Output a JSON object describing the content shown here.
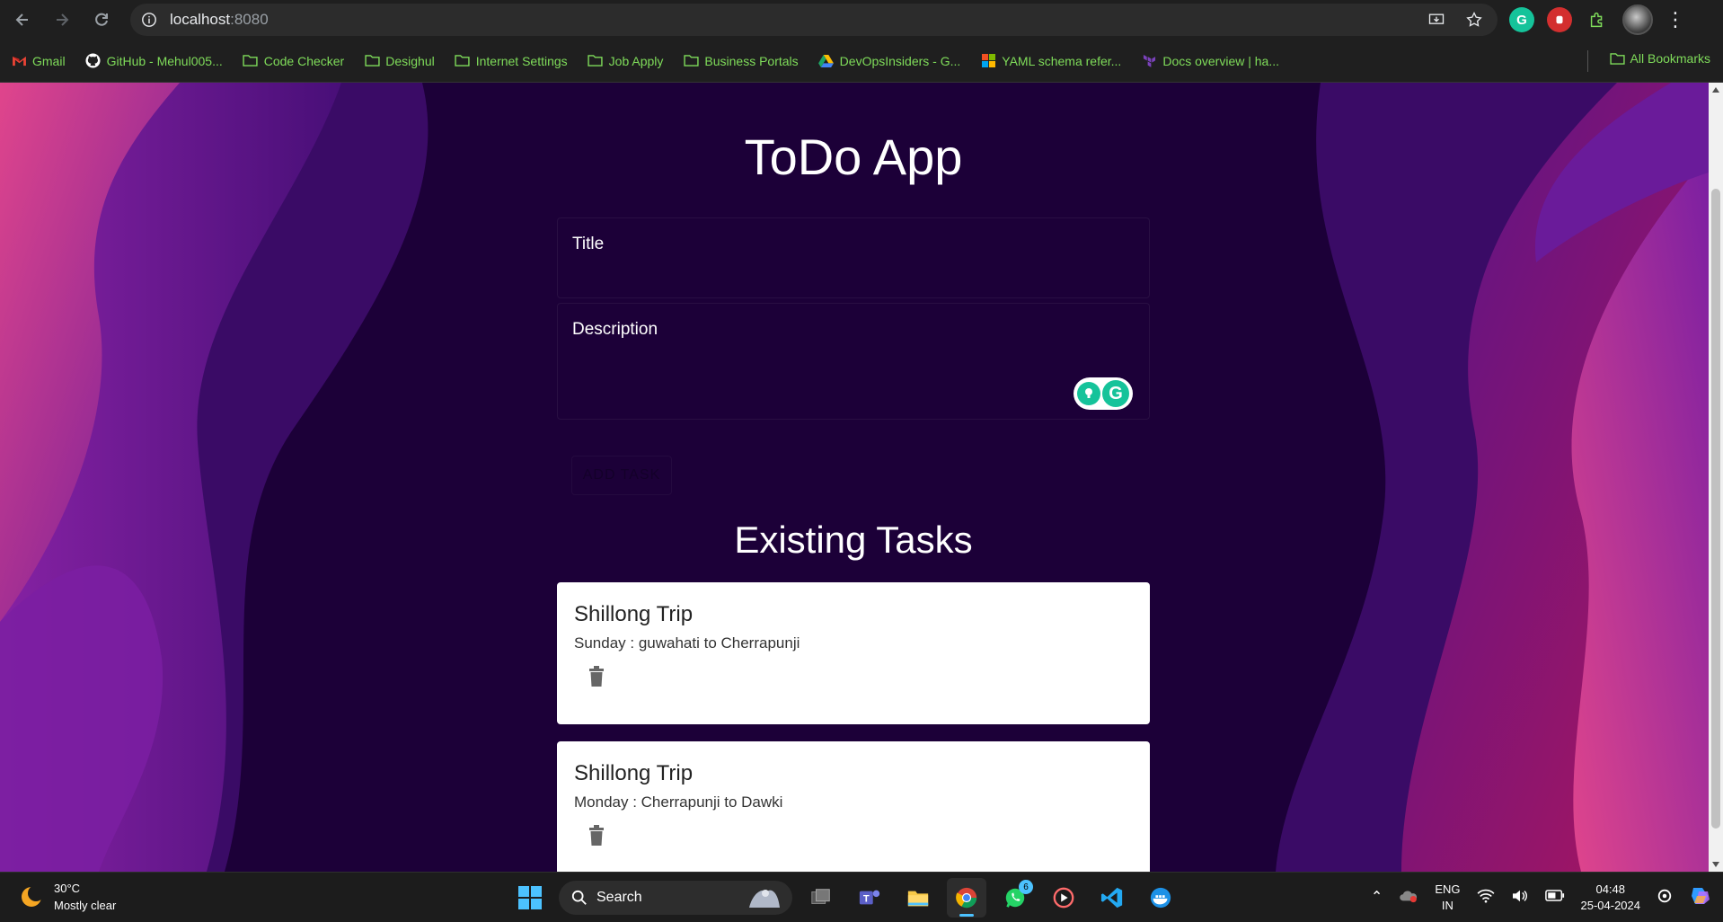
{
  "browser": {
    "url_host": "localhost",
    "url_port": ":8080",
    "bookmarks": [
      {
        "label": "Gmail",
        "icon": "gmail-icon"
      },
      {
        "label": "GitHub - Mehul005...",
        "icon": "github-icon"
      },
      {
        "label": "Code Checker",
        "icon": "folder-icon"
      },
      {
        "label": "Desighul",
        "icon": "folder-icon"
      },
      {
        "label": "Internet Settings",
        "icon": "folder-icon"
      },
      {
        "label": "Job Apply",
        "icon": "folder-icon"
      },
      {
        "label": "Business Portals",
        "icon": "folder-icon"
      },
      {
        "label": "DevOpsInsiders - G...",
        "icon": "drive-icon"
      },
      {
        "label": "YAML schema refer...",
        "icon": "microsoft-icon"
      },
      {
        "label": "Docs overview | ha...",
        "icon": "terraform-icon"
      }
    ],
    "all_bookmarks": "All Bookmarks"
  },
  "app": {
    "title": "ToDo App",
    "title_label": "Title",
    "description_label": "Description",
    "add_button": "ADD TASK",
    "section_title": "Existing Tasks",
    "tasks": [
      {
        "title": "Shillong Trip",
        "description": "Sunday : guwahati to Cherrapunji"
      },
      {
        "title": "Shillong Trip",
        "description": "Monday : Cherrapunji to Dawki"
      }
    ]
  },
  "taskbar": {
    "weather_temp": "30°C",
    "weather_desc": "Mostly clear",
    "search_label": "Search",
    "whatsapp_badge": "6",
    "lang_top": "ENG",
    "lang_bottom": "IN",
    "time": "04:48",
    "date": "25-04-2024"
  },
  "colors": {
    "page_bg": "#1c0038",
    "bookmark_text": "#7fdc5a",
    "accent": "#4cc2ff"
  }
}
